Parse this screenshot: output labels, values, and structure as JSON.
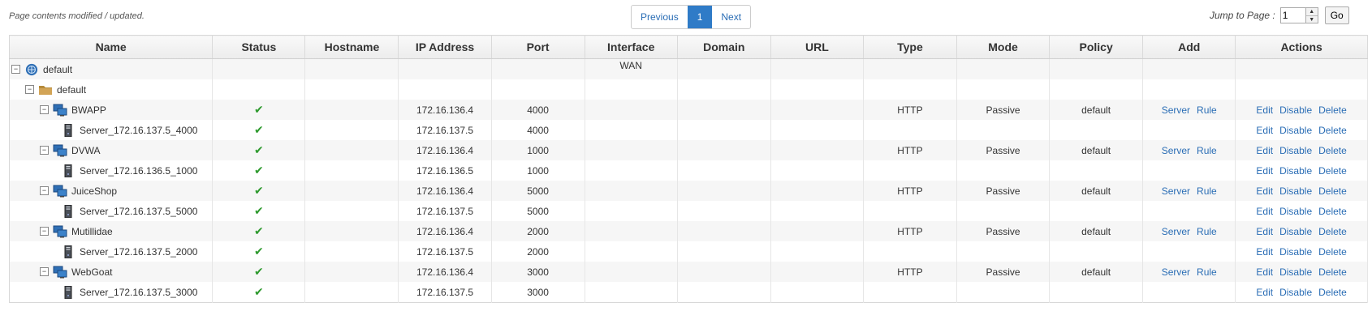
{
  "status_message": "Page contents modified / updated.",
  "pagination": {
    "previous": "Previous",
    "current": "1",
    "next": "Next"
  },
  "jump": {
    "label": "Jump to Page :",
    "value": "1",
    "go": "Go"
  },
  "columns": [
    "Name",
    "Status",
    "Hostname",
    "IP Address",
    "Port",
    "Interface",
    "Domain",
    "URL",
    "Type",
    "Mode",
    "Policy",
    "Add",
    "Actions"
  ],
  "root": {
    "name": "default",
    "interface": "WAN"
  },
  "folder": {
    "name": "default"
  },
  "services": [
    {
      "name": "BWAPP",
      "ip": "172.16.136.4",
      "port": "4000",
      "type": "HTTP",
      "mode": "Passive",
      "policy": "default",
      "server": {
        "name": "Server_172.16.137.5_4000",
        "ip": "172.16.137.5",
        "port": "4000"
      }
    },
    {
      "name": "DVWA",
      "ip": "172.16.136.4",
      "port": "1000",
      "type": "HTTP",
      "mode": "Passive",
      "policy": "default",
      "server": {
        "name": "Server_172.16.136.5_1000",
        "ip": "172.16.136.5",
        "port": "1000"
      }
    },
    {
      "name": "JuiceShop",
      "ip": "172.16.136.4",
      "port": "5000",
      "type": "HTTP",
      "mode": "Passive",
      "policy": "default",
      "server": {
        "name": "Server_172.16.137.5_5000",
        "ip": "172.16.137.5",
        "port": "5000"
      }
    },
    {
      "name": "Mutillidae",
      "ip": "172.16.136.4",
      "port": "2000",
      "type": "HTTP",
      "mode": "Passive",
      "policy": "default",
      "server": {
        "name": "Server_172.16.137.5_2000",
        "ip": "172.16.137.5",
        "port": "2000"
      }
    },
    {
      "name": "WebGoat",
      "ip": "172.16.136.4",
      "port": "3000",
      "type": "HTTP",
      "mode": "Passive",
      "policy": "default",
      "server": {
        "name": "Server_172.16.137.5_3000",
        "ip": "172.16.137.5",
        "port": "3000"
      }
    }
  ],
  "add_links": {
    "server": "Server",
    "rule": "Rule"
  },
  "action_links": {
    "edit": "Edit",
    "disable": "Disable",
    "delete": "Delete"
  },
  "status_check": "✔",
  "icons": {
    "toggle": "collapse-icon",
    "root": "network-globe-icon",
    "folder": "folder-icon",
    "service": "service-monitor-icon",
    "server": "server-tower-icon"
  },
  "colors": {
    "link": "#2a6db5",
    "accent": "#2f7bc7",
    "check": "#2e9a2e"
  }
}
